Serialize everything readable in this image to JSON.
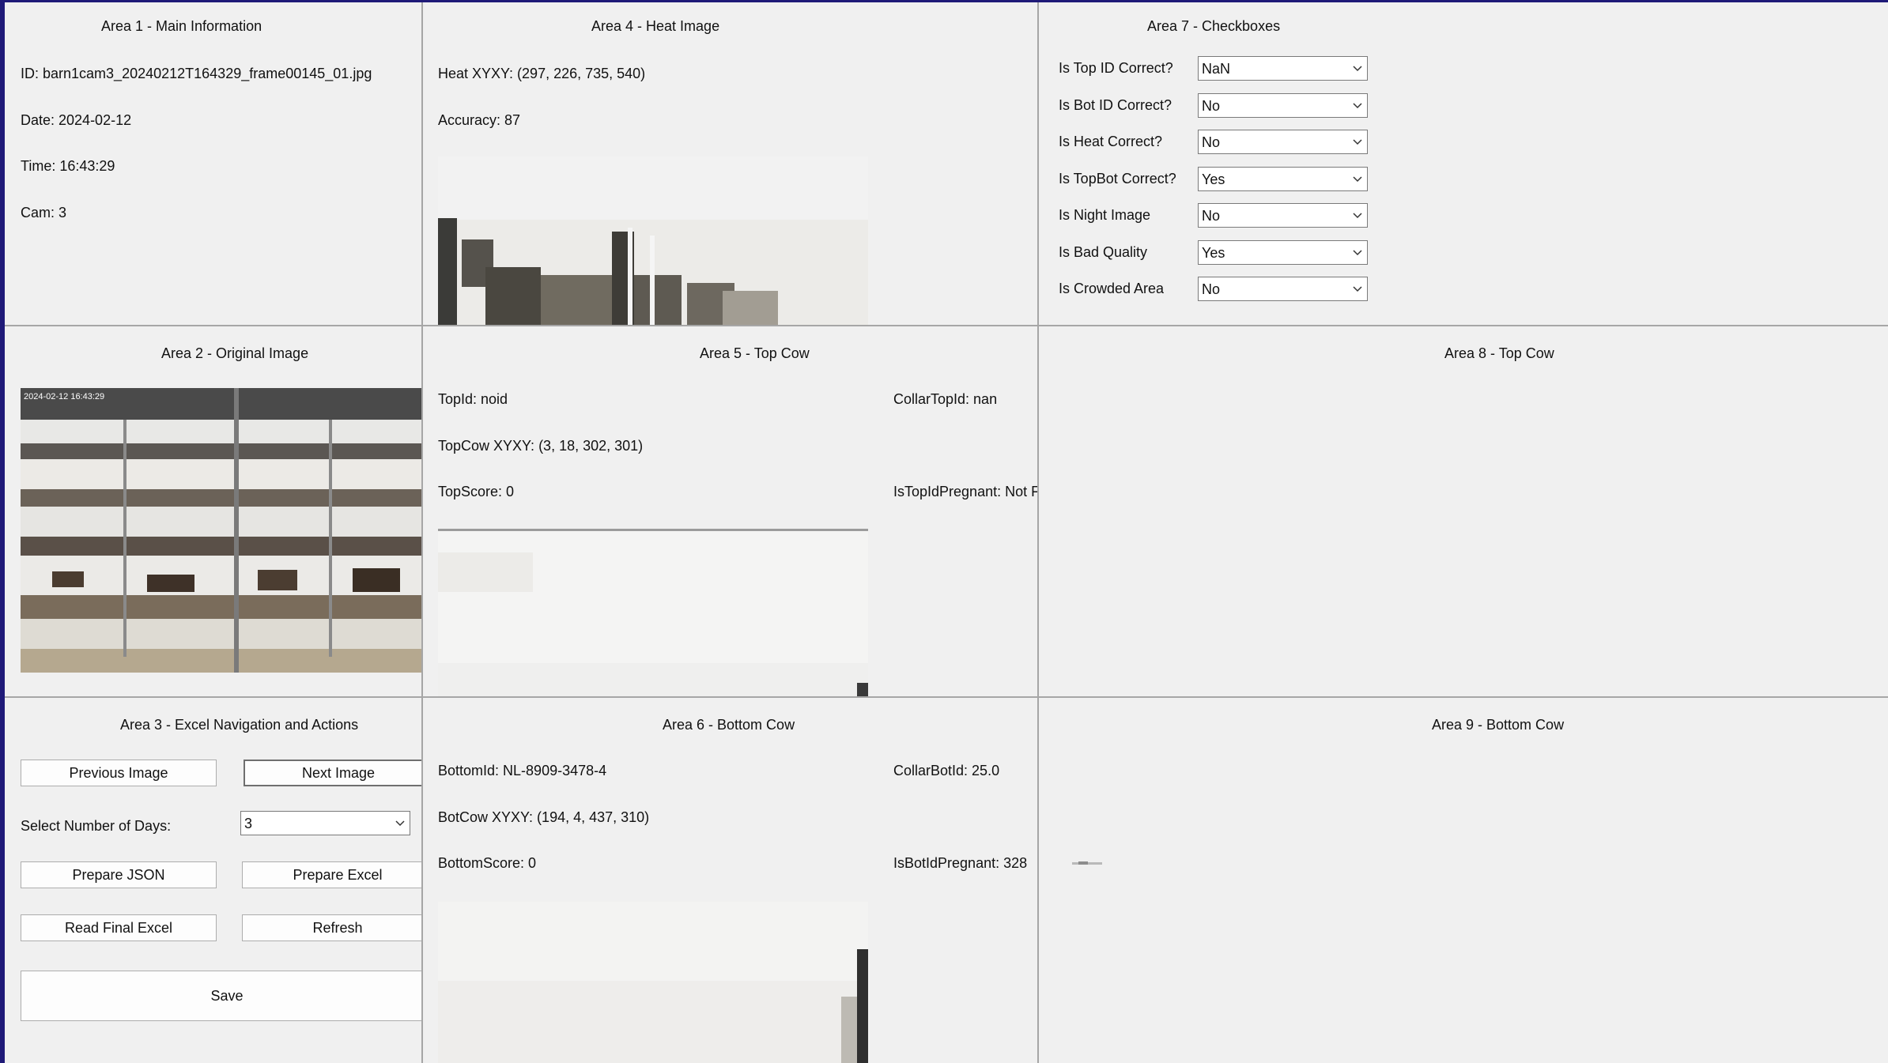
{
  "area1": {
    "title": "Area 1 - Main Information",
    "id": "ID: barn1cam3_20240212T164329_frame00145_01.jpg",
    "date": "Date: 2024-02-12",
    "time": "Time: 16:43:29",
    "cam": "Cam: 3"
  },
  "area2": {
    "title": "Area 2 - Original Image",
    "overlay_text": "2024-02-12 16:43:29"
  },
  "area3": {
    "title": "Area 3 - Excel Navigation and Actions",
    "prev_label": "Previous Image",
    "next_label": "Next Image",
    "days_label": "Select Number of Days:",
    "days_value": "3",
    "prepare_json_label": "Prepare JSON",
    "prepare_excel_label": "Prepare Excel",
    "read_final_label": "Read Final Excel",
    "refresh_label": "Refresh",
    "save_label": "Save"
  },
  "area4": {
    "title": "Area 4 - Heat Image",
    "heat_xyxy": "Heat XYXY: (297, 226, 735, 540)",
    "accuracy": "Accuracy: 87"
  },
  "area5": {
    "title": "Area 5 - Top Cow",
    "top_id": "TopId: noid",
    "collar_top_id": "CollarTopId: nan",
    "topcow_xyxy": "TopCow XYXY: (3, 18, 302, 301)",
    "is_top_pregnant": "IsTopIdPregnant: Not F",
    "top_score": "TopScore: 0"
  },
  "area6": {
    "title": "Area 6 - Bottom Cow",
    "bottom_id": "BottomId: NL-8909-3478-4",
    "collar_bot_id": "CollarBotId: 25.0",
    "botcow_xyxy": "BotCow XYXY: (194, 4, 437, 310)",
    "is_bot_pregnant": "IsBotIdPregnant: 328",
    "bottom_score": "BottomScore: 0"
  },
  "area7": {
    "title": "Area 7 - Checkboxes",
    "rows": [
      {
        "label": "Is Top ID Correct?",
        "value": "NaN"
      },
      {
        "label": "Is Bot ID Correct?",
        "value": "No"
      },
      {
        "label": "Is Heat Correct?",
        "value": "No"
      },
      {
        "label": "Is TopBot Correct?",
        "value": "Yes"
      },
      {
        "label": "Is Night Image",
        "value": "No"
      },
      {
        "label": "Is Bad Quality",
        "value": "Yes"
      },
      {
        "label": "Is Crowded Area",
        "value": "No"
      }
    ]
  },
  "area8": {
    "title": "Area 8 - Top Cow"
  },
  "area9": {
    "title": "Area 9 - Bottom Cow"
  },
  "colors": {
    "window_bg": "#f0f0f0",
    "frame": "#1f1a78",
    "divider": "#a6a6a6"
  },
  "icons": {
    "combo_arrow": "chevron-down-icon"
  }
}
